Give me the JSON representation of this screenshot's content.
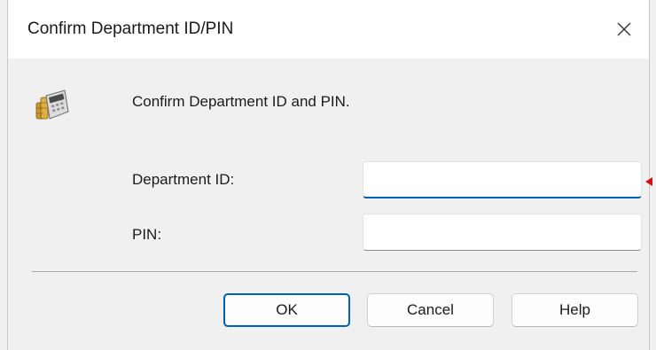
{
  "window": {
    "title": "Confirm Department ID/PIN",
    "close_icon": "close-icon"
  },
  "dialog": {
    "icon": "department-id-icon",
    "message": "Confirm Department ID and PIN.",
    "department_id": {
      "label": "Department ID:",
      "value": ""
    },
    "pin": {
      "label": "PIN:",
      "value": ""
    }
  },
  "buttons": {
    "ok": "OK",
    "cancel": "Cancel",
    "help": "Help"
  },
  "colors": {
    "accent": "#005fb8",
    "marker": "#d01010"
  }
}
